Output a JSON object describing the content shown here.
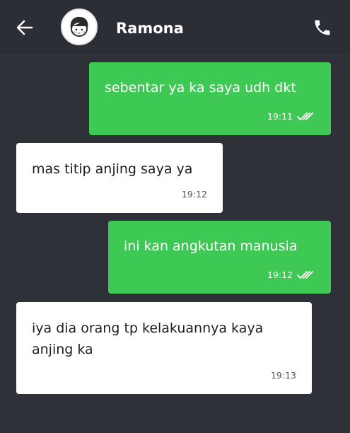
{
  "header": {
    "contact_name": "Ramona",
    "back_icon": "arrow-left-icon",
    "avatar_icon": "avatar-face-icon",
    "call_icon": "phone-icon"
  },
  "colors": {
    "background": "#2e3138",
    "header": "#2b2e35",
    "outgoing_bubble": "#3ec854",
    "incoming_bubble": "#ffffff"
  },
  "messages": [
    {
      "direction": "out",
      "text": "sebentar ya ka saya udh dkt",
      "time": "19:11",
      "status": "read-double-check"
    },
    {
      "direction": "in",
      "text": "mas titip anjing saya ya",
      "time": "19:12"
    },
    {
      "direction": "out",
      "text": "ini kan angkutan manusia",
      "time": "19:12",
      "status": "read-double-check"
    },
    {
      "direction": "in",
      "text": "iya dia orang tp kelakuannya kaya\nanjing ka",
      "time": "19:13"
    }
  ]
}
